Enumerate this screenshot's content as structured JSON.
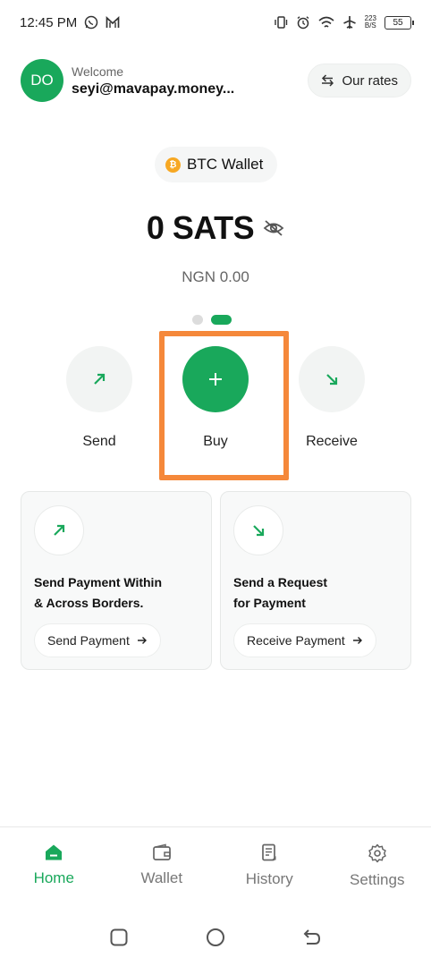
{
  "status_bar": {
    "time": "12:45 PM",
    "net_speed_value": "223",
    "net_speed_unit": "B/S",
    "battery": "55"
  },
  "header": {
    "avatar_initials": "DO",
    "welcome": "Welcome",
    "email": "seyi@mavapay.money...",
    "rates_label": "Our rates"
  },
  "wallet": {
    "label": "BTC Wallet",
    "balance": "0 SATS",
    "fiat": "NGN 0.00",
    "page_count": 2,
    "active_page": 2
  },
  "actions": [
    {
      "label": "Send",
      "icon": "arrow-up-right-icon"
    },
    {
      "label": "Buy",
      "icon": "plus-icon"
    },
    {
      "label": "Receive",
      "icon": "arrow-down-right-icon"
    }
  ],
  "cards": [
    {
      "title_line1": "Send Payment Within",
      "title_line2": "& Across Borders.",
      "button": "Send Payment"
    },
    {
      "title_line1": "Send a Request",
      "title_line2": "for Payment",
      "button": "Receive Payment"
    }
  ],
  "nav": [
    {
      "label": "Home",
      "icon": "home-icon",
      "active": true
    },
    {
      "label": "Wallet",
      "icon": "wallet-icon",
      "active": false
    },
    {
      "label": "History",
      "icon": "history-icon",
      "active": false
    },
    {
      "label": "Settings",
      "icon": "gear-icon",
      "active": false
    }
  ],
  "colors": {
    "brand": "#19a85b",
    "highlight": "#f5883a",
    "btc": "#f7a823"
  }
}
